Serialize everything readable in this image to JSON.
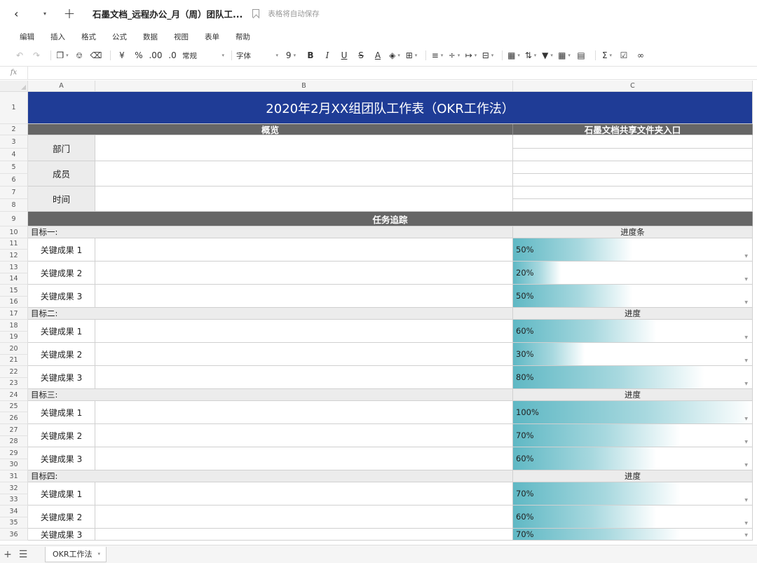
{
  "titlebar": {
    "doc_title": "石墨文档_远程办公_月（周）团队工...",
    "autosave": "表格将自动保存"
  },
  "menu": [
    "编辑",
    "插入",
    "格式",
    "公式",
    "数据",
    "视图",
    "表单",
    "帮助"
  ],
  "toolbar": {
    "currency": "¥",
    "percent": "%",
    "dec_inc": ".00",
    "dec_dec": ".0",
    "number_format": "常规",
    "font": "字体",
    "font_size": "9",
    "bold": "B",
    "italic": "I",
    "underline": "U",
    "strike": "S",
    "text_color": "A",
    "sum": "Σ"
  },
  "formula": {
    "fx_label": "fx"
  },
  "columns": [
    "A",
    "B",
    "C"
  ],
  "rows": [
    "1",
    "2",
    "3",
    "4",
    "5",
    "6",
    "7",
    "8",
    "9",
    "10",
    "11",
    "12",
    "13",
    "14",
    "15",
    "16",
    "17",
    "18",
    "19",
    "20",
    "21",
    "22",
    "23",
    "24",
    "25",
    "26",
    "27",
    "28",
    "29",
    "30",
    "31",
    "32",
    "33",
    "34",
    "35",
    "36"
  ],
  "sheet": {
    "title": "2020年2月XX组团队工作表（OKR工作法）",
    "overview_header": "概览",
    "folder_header": "石墨文档共享文件夹入口",
    "info_labels": [
      "部门",
      "成员",
      "时间"
    ],
    "tracking_header": "任务追踪",
    "objectives": [
      {
        "name": "目标一:",
        "progress_header": "进度条",
        "krs": [
          {
            "label": "关键成果 1",
            "progress": "50%"
          },
          {
            "label": "关键成果 2",
            "progress": "20%"
          },
          {
            "label": "关键成果 3",
            "progress": "50%"
          }
        ]
      },
      {
        "name": "目标二:",
        "progress_header": "进度",
        "krs": [
          {
            "label": "关键成果 1",
            "progress": "60%"
          },
          {
            "label": "关键成果 2",
            "progress": "30%"
          },
          {
            "label": "关键成果 3",
            "progress": "80%"
          }
        ]
      },
      {
        "name": "目标三:",
        "progress_header": "进度",
        "krs": [
          {
            "label": "关键成果 1",
            "progress": "100%"
          },
          {
            "label": "关键成果 2",
            "progress": "70%"
          },
          {
            "label": "关键成果 3",
            "progress": "60%"
          }
        ]
      },
      {
        "name": "目标四:",
        "progress_header": "进度",
        "krs": [
          {
            "label": "关键成果 1",
            "progress": "70%"
          },
          {
            "label": "关键成果 2",
            "progress": "60%"
          },
          {
            "label": "关键成果 3",
            "progress": "70%"
          }
        ]
      }
    ]
  },
  "tabs": {
    "sheet_tab": "OKR工作法"
  },
  "colors": {
    "title_bg": "#1f3c96",
    "header_bg": "#666666",
    "progress": "#5fb8c4"
  }
}
